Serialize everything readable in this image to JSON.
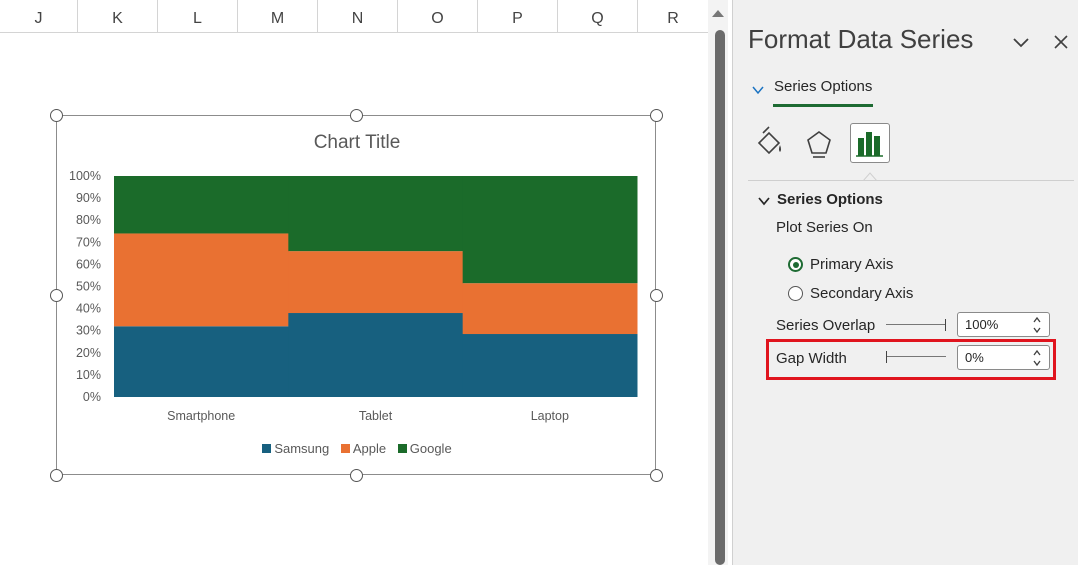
{
  "sheet": {
    "columns": [
      "J",
      "K",
      "L",
      "M",
      "N",
      "O",
      "P",
      "Q",
      "R"
    ]
  },
  "chart_data": {
    "type": "bar",
    "stacked": "percent",
    "title": "Chart Title",
    "categories": [
      "Smartphone",
      "Tablet",
      "Laptop"
    ],
    "series": [
      {
        "name": "Samsung",
        "color": "#17607f",
        "values": [
          32,
          38,
          28.5
        ]
      },
      {
        "name": "Apple",
        "color": "#e97132",
        "values": [
          42,
          28,
          23
        ]
      },
      {
        "name": "Google",
        "color": "#1b6b2a",
        "values": [
          26,
          34,
          48.5
        ]
      }
    ],
    "y_ticks": [
      "0%",
      "10%",
      "20%",
      "30%",
      "40%",
      "50%",
      "60%",
      "70%",
      "80%",
      "90%",
      "100%"
    ],
    "ylim": [
      0,
      100
    ],
    "gap_width_percent": 0,
    "legend": "bottom",
    "grid": false
  },
  "pane": {
    "title": "Format Data Series",
    "tab_label": "Series Options",
    "section_title": "Series Options",
    "plot_series_on": "Plot Series On",
    "primary_axis": "Primary Axis",
    "secondary_axis": "Secondary Axis",
    "selected_axis": "primary",
    "series_overlap_label": "Series Overlap",
    "series_overlap_value": "100%",
    "series_overlap_level": 1.0,
    "gap_width_label": "Gap Width",
    "gap_width_value": "0%",
    "gap_width_level": 0.0,
    "icons": [
      "fill-line-icon",
      "effects-icon",
      "series-options-icon"
    ],
    "accent": "#1e6b33",
    "highlight_color": "#e0141e"
  }
}
